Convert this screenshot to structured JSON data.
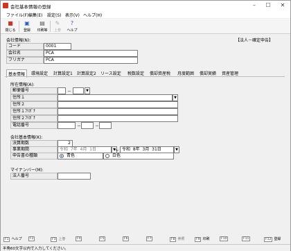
{
  "window": {
    "title": "会社基本情報の登録"
  },
  "menu": [
    "ファイル(F)",
    "編集(E)",
    "設定(S)",
    "表示(V)",
    "ヘルプ(H)"
  ],
  "toolbar": {
    "close": "閉じる",
    "register": "登録",
    "print_preview": "印刷等",
    "up": "上巻",
    "help": "ヘルプ"
  },
  "company": {
    "section": "会社情報(N):",
    "code_label": "コード",
    "code_value": "0001",
    "name_label": "会社名",
    "name_value": "PCA",
    "kana_label": "フリガナ",
    "kana_value": "PCA",
    "mode": "【法人－確定申告】"
  },
  "tabs": [
    "基本情報",
    "環境設定",
    "計算設定1",
    "計算設定2",
    "リース設定",
    "税数設定",
    "償却資産税",
    "月度範囲",
    "償却実績",
    "資産管理"
  ],
  "address": {
    "section": "所在情報(A):",
    "rows": [
      "郵便番号",
      "住所１",
      "住所２",
      "住所１ﾌﾘｶﾞﾅ",
      "住所２ﾌﾘｶﾞﾅ",
      "電話番号"
    ]
  },
  "basic": {
    "section": "会社基本情報(K):",
    "fiscal_label": "決算期数",
    "fiscal_value": "2",
    "period_label": "事業期間",
    "start": {
      "era": "令和",
      "year": "7年",
      "month": "4月",
      "day": "1日"
    },
    "tilde": "～",
    "end": {
      "era": "令和",
      "year": "8年",
      "month": "3月",
      "day": "31日"
    },
    "filing_label": "申告書の種類",
    "blue": "青色",
    "white": "白色"
  },
  "mynumber": {
    "section": "マイナンバー(M):",
    "corp_label": "法人番号"
  },
  "fkeys": [
    {
      "key": "F1",
      "label": "ヘルプ",
      "on": true
    },
    {
      "key": "F2",
      "label": "",
      "on": false
    },
    {
      "key": "F3",
      "label": "上巻",
      "on": false
    },
    {
      "key": "F4",
      "label": "",
      "on": false
    },
    {
      "key": "F5",
      "label": "",
      "on": false
    },
    {
      "key": "F6",
      "label": "",
      "on": false
    },
    {
      "key": "F7",
      "label": "",
      "on": false
    },
    {
      "key": "F8",
      "label": "参照",
      "on": false
    },
    {
      "key": "F9",
      "label": "印刷",
      "on": true
    },
    {
      "key": "F10",
      "label": "",
      "on": false
    },
    {
      "key": "F11",
      "label": "",
      "on": false
    },
    {
      "key": "F12",
      "label": "登録",
      "on": true
    }
  ],
  "status": "半角60文字以内で入力してください。"
}
